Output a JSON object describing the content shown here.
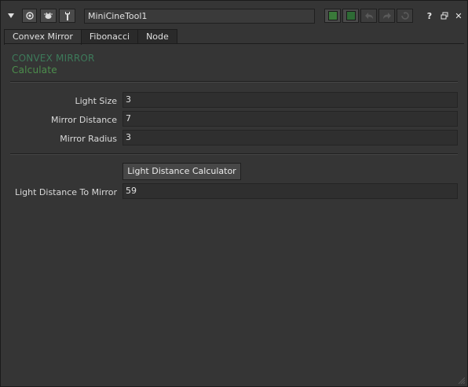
{
  "toolbar": {
    "node_name": "MiniCineTool1",
    "icons": [
      "collapse-arrow-icon",
      "node-view-icon",
      "bug-icon",
      "wrench-icon",
      "green-swatch-icon",
      "dark-green-swatch-icon",
      "undo-icon",
      "redo-icon",
      "revert-icon",
      "help-icon",
      "float-icon",
      "close-icon"
    ],
    "help_label": "?",
    "close_label": "✕"
  },
  "tabs": [
    {
      "label": "Convex Mirror",
      "active": true
    },
    {
      "label": "Fibonacci",
      "active": false
    },
    {
      "label": "Node",
      "active": false
    }
  ],
  "headings": {
    "title": "CONVEX MIRROR",
    "subtitle": "Calculate",
    "title_color": "#3d7a5a",
    "subtitle_color": "#4d8f4d"
  },
  "inputs": {
    "light_size": {
      "label": "Light Size",
      "value": "3"
    },
    "mirror_distance": {
      "label": "Mirror Distance",
      "value": "7"
    },
    "mirror_radius": {
      "label": "Mirror Radius",
      "value": "3"
    }
  },
  "calc_button_label": "Light Distance Calculator",
  "output": {
    "label": "Light Distance To Mirror",
    "value": "59"
  }
}
